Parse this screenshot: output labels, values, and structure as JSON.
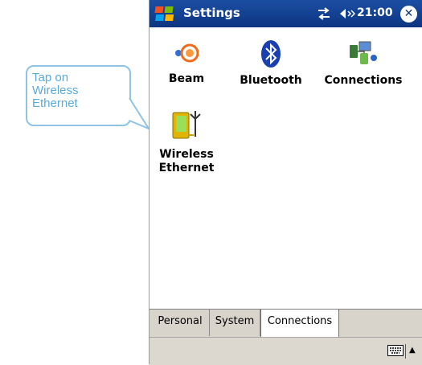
{
  "callout": {
    "text_lines": [
      "Tap on",
      "Wireless",
      "Ethernet"
    ]
  },
  "titlebar": {
    "title": "Settings",
    "time": "21:00",
    "close_label": "✕"
  },
  "items": [
    {
      "label": "Beam"
    },
    {
      "label": "Bluetooth"
    },
    {
      "label": "Connections"
    },
    {
      "label_lines": [
        "Wireless",
        "Ethernet"
      ]
    }
  ],
  "tabs": [
    {
      "label": "Personal"
    },
    {
      "label": "System"
    },
    {
      "label": "Connections",
      "active": true
    }
  ],
  "colors": {
    "titlebar": "#0d3581",
    "callout": "#8fc3e6",
    "callout_text": "#5aa9dd"
  },
  "icons": [
    "windows-start-icon",
    "connectivity-icon",
    "volume-icon",
    "close-icon",
    "beam-icon",
    "bluetooth-icon",
    "connections-icon",
    "wireless-ethernet-icon",
    "keyboard-icon"
  ]
}
